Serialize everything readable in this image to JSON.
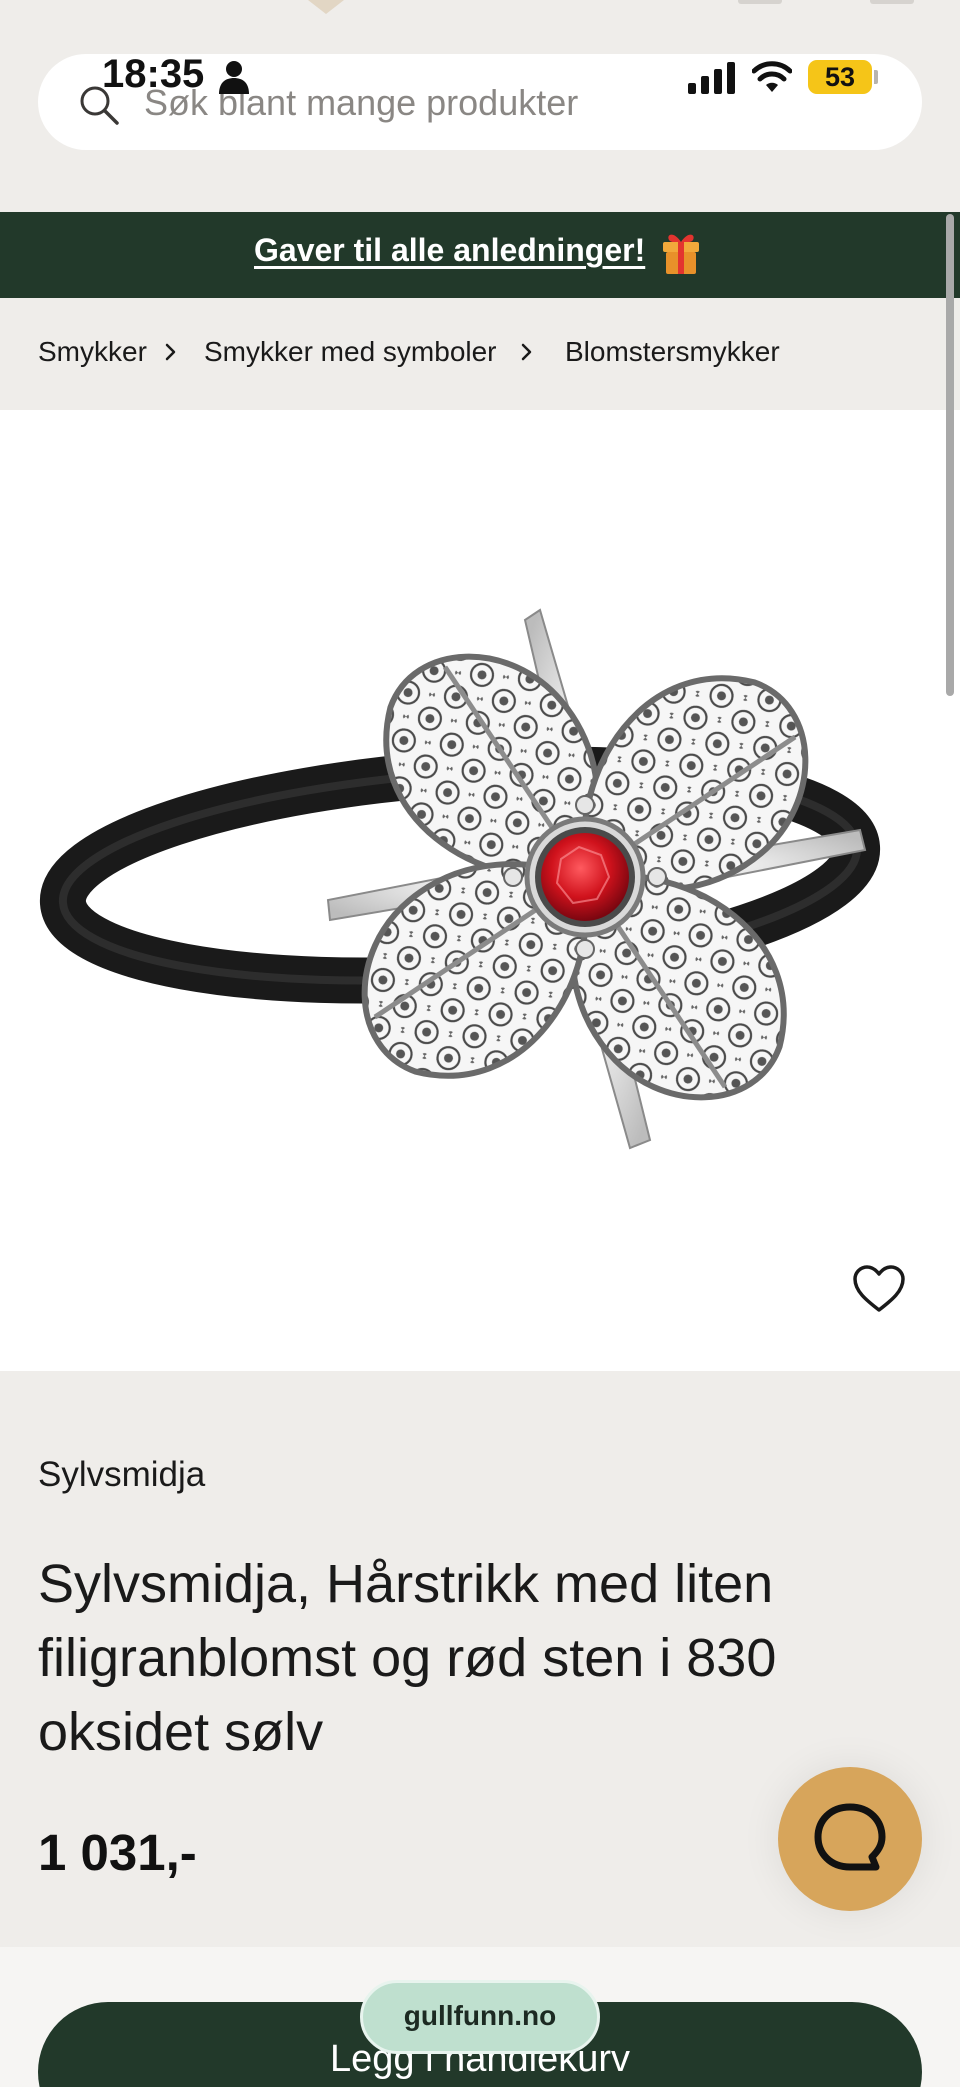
{
  "status_bar": {
    "time": "18:35",
    "battery": "53",
    "icons": [
      "person-icon",
      "signal-icon",
      "wifi-icon",
      "battery-icon"
    ]
  },
  "search": {
    "placeholder": "Søk blant mange produkter",
    "icon": "search-icon"
  },
  "promo": {
    "text": "Gaver til alle anledninger!",
    "icon": "gift-icon"
  },
  "breadcrumb": {
    "items": [
      "Smykker",
      "Smykker med symboler",
      "Blomstersmykker"
    ],
    "separator_icon": "chevron-right-icon"
  },
  "product": {
    "image_icon": "filigree-flower-hair-tie-image",
    "favorite_icon": "heart-icon",
    "brand": "Sylvsmidja",
    "title": "Sylvsmidja, Hårstrikk med liten filigranblomst og rød sten i 830 oksidet sølv",
    "price": "1 031,-"
  },
  "actions": {
    "add_to_cart": "Legg i handlekurv",
    "chat_icon": "chat-bubble-icon"
  },
  "browser": {
    "domain": "gullfunn.no"
  },
  "colors": {
    "dark_green": "#22392a",
    "page_bg": "#efedea",
    "gold": "#d7a55b",
    "battery_yellow": "#f5c518",
    "stone_red": "#d0121c"
  }
}
